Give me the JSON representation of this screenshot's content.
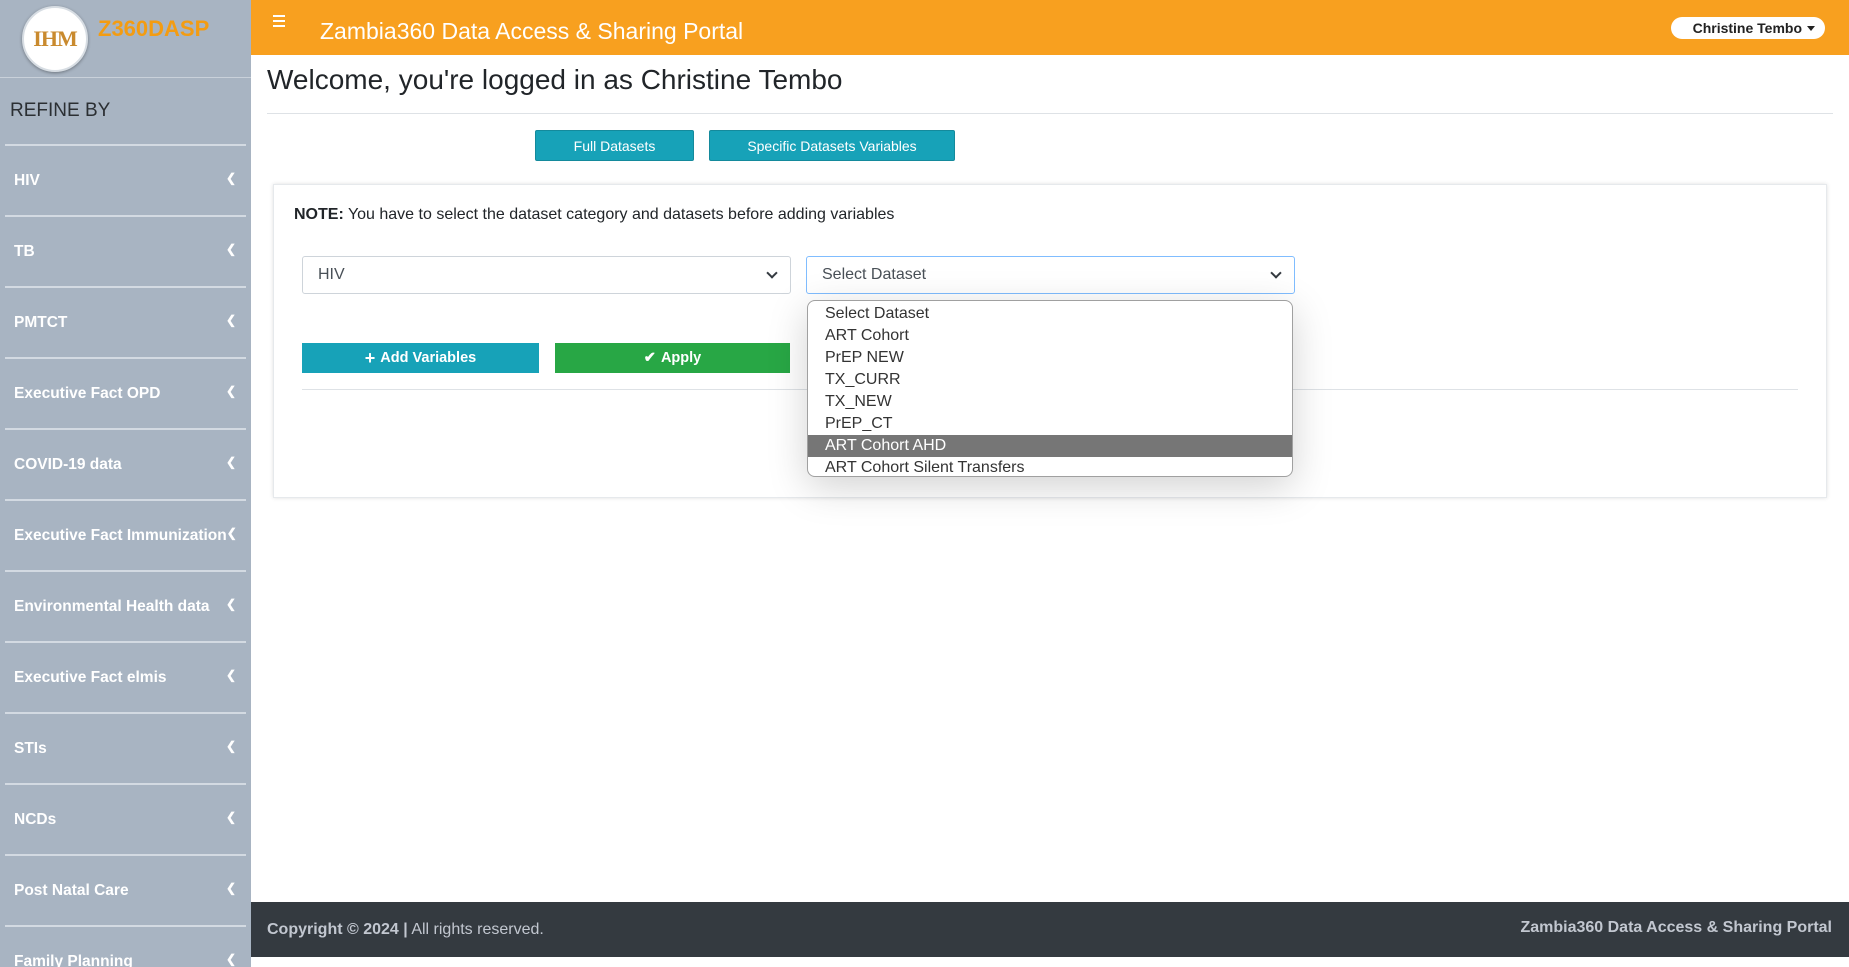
{
  "brand": {
    "logo_text": "IHM",
    "name": "Z360DASP"
  },
  "sidebar": {
    "heading": "REFINE BY",
    "items": [
      {
        "label": "HIV"
      },
      {
        "label": "TB"
      },
      {
        "label": "PMTCT"
      },
      {
        "label": "Executive Fact OPD"
      },
      {
        "label": "COVID-19 data"
      },
      {
        "label": "Executive Fact Immunization"
      },
      {
        "label": "Environmental Health data"
      },
      {
        "label": "Executive Fact elmis"
      },
      {
        "label": "STIs"
      },
      {
        "label": "NCDs"
      },
      {
        "label": "Post Natal Care"
      },
      {
        "label": "Family Planning"
      }
    ]
  },
  "header": {
    "title": "Zambia360 Data Access & Sharing Portal",
    "user": "Christine Tembo"
  },
  "main": {
    "welcome": "Welcome, you're logged in as Christine Tembo",
    "tabs": [
      {
        "label": "Full Datasets"
      },
      {
        "label": "Specific Datasets Variables"
      }
    ],
    "note_label": "NOTE:",
    "note_text": " You have to select the dataset category and datasets before adding variables",
    "category_select": {
      "value": "HIV"
    },
    "dataset_select": {
      "value": "Select Dataset",
      "options": [
        "Select Dataset",
        "ART Cohort",
        "PrEP NEW",
        "TX_CURR",
        "TX_NEW",
        "PrEP_CT",
        "ART Cohort AHD",
        "ART Cohort Silent Transfers"
      ],
      "highlighted": "ART Cohort AHD"
    },
    "add_variables_label": "Add Variables",
    "apply_label": "Apply"
  },
  "footer": {
    "copyright": "Copyright © 2024 |",
    "rights": " All rights reserved.",
    "right_text": "Zambia360 Data Access & Sharing Portal"
  },
  "colors": {
    "topbar": "#f8a01f",
    "sidebar": "#a8b4c2",
    "info_button": "#17a2b8",
    "success_button": "#28a745",
    "footer": "#343a40",
    "highlight_option": "#767676"
  }
}
